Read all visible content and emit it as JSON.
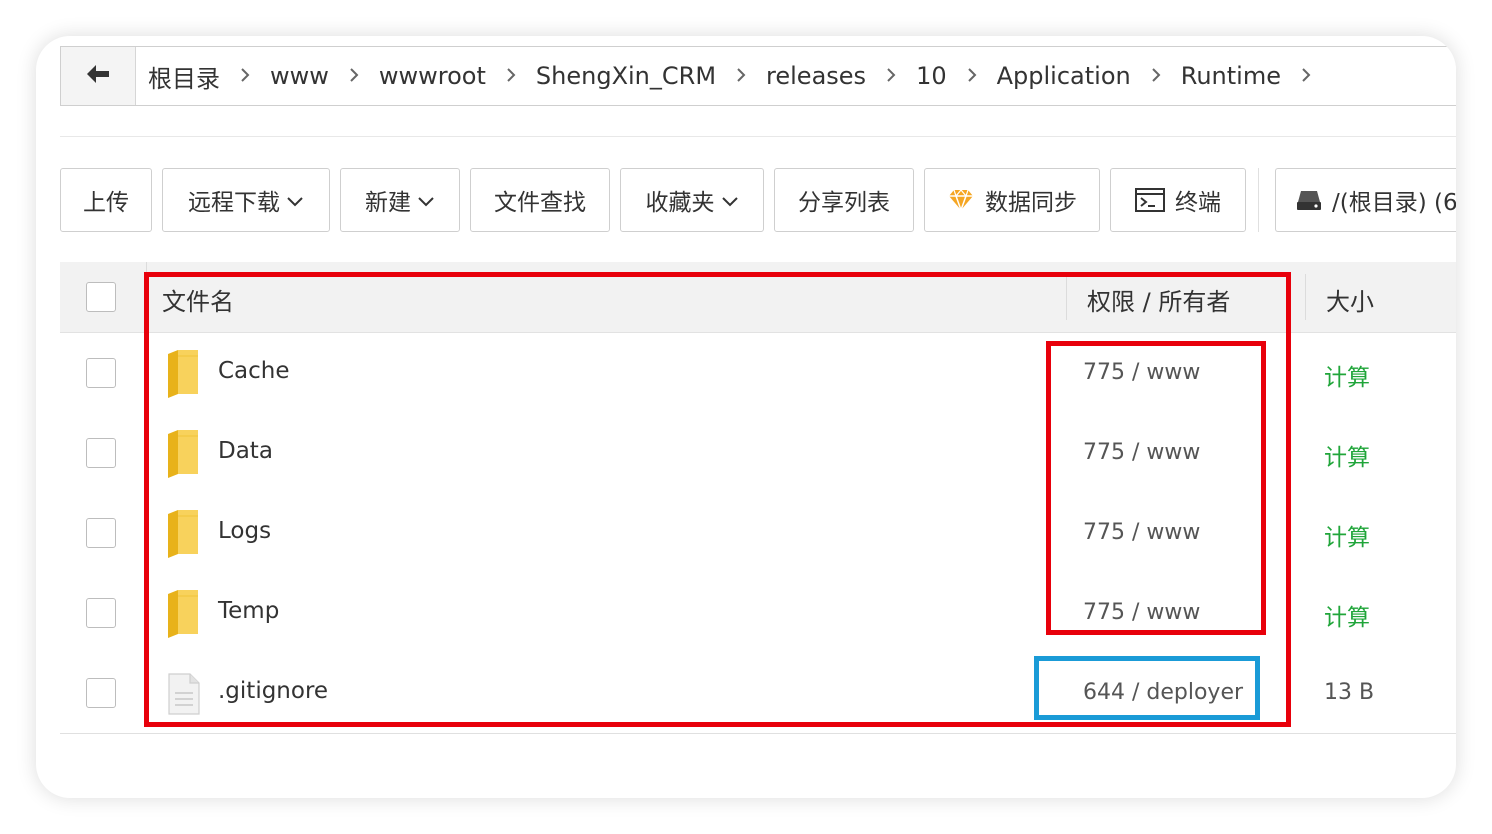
{
  "breadcrumb": {
    "items": [
      "根目录",
      "www",
      "wwwroot",
      "ShengXin_CRM",
      "releases",
      "10",
      "Application",
      "Runtime"
    ],
    "separator": ">"
  },
  "toolbar": {
    "upload": "上传",
    "remote_download": "远程下载",
    "new": "新建",
    "file_search": "文件查找",
    "favorites": "收藏夹",
    "share_list": "分享列表",
    "data_sync": "数据同步",
    "terminal": "终端",
    "disk": "/(根目录) (6"
  },
  "table": {
    "headers": {
      "name": "文件名",
      "permission": "权限 / 所有者",
      "size": "大小"
    },
    "rows": [
      {
        "name": "Cache",
        "type": "folder",
        "permission": "775 / www",
        "size": "计算"
      },
      {
        "name": "Data",
        "type": "folder",
        "permission": "775 / www",
        "size": "计算"
      },
      {
        "name": "Logs",
        "type": "folder",
        "permission": "775 / www",
        "size": "计算"
      },
      {
        "name": "Temp",
        "type": "folder",
        "permission": "775 / www",
        "size": "计算"
      },
      {
        "name": ".gitignore",
        "type": "file",
        "permission": "644 / deployer",
        "size": "13 B"
      }
    ]
  },
  "colors": {
    "accent_green": "#20a53a",
    "annotation_red": "#e8000b",
    "annotation_blue": "#1a9bd7",
    "folder_yellow": "#f5c518"
  },
  "icons": {
    "back": "arrow-left-icon",
    "folder": "folder-icon",
    "file": "file-icon",
    "diamond": "diamond-icon",
    "terminal": "terminal-icon",
    "disk": "disk-icon"
  }
}
